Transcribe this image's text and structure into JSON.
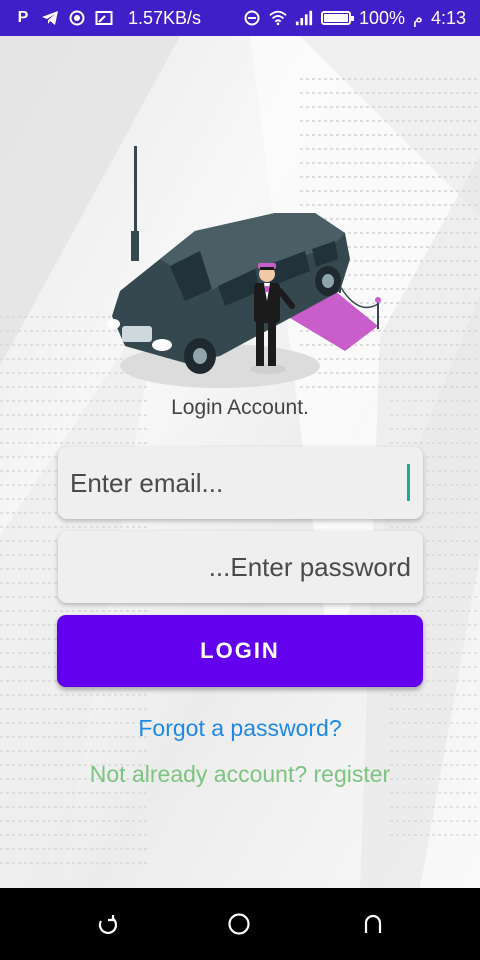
{
  "status_bar": {
    "left_icons": [
      "parking-icon",
      "telegram-icon",
      "data-saver-icon",
      "screen-cast-icon"
    ],
    "network_speed": "1.57KB/s",
    "right_icons": [
      "do-not-disturb-icon",
      "wifi-icon",
      "signal-icon"
    ],
    "battery_percent": "100%",
    "battery_level": 1.0,
    "am_pm": "م",
    "time": "4:13"
  },
  "illustration": {
    "name": "limousine-with-chauffeur-illustration",
    "colors": {
      "car_body": "#36484f",
      "carpet": "#c85ec9",
      "suit": "#1b1b1b"
    }
  },
  "login": {
    "title": "Login Account.",
    "email_placeholder": "Enter email...",
    "password_placeholder": "...Enter password",
    "login_button": "LOGIN",
    "forgot_link": "Forgot a password?",
    "register_link": "Not already account? register"
  },
  "nav_bar": {
    "buttons": [
      "back-icon",
      "home-icon",
      "recents-icon"
    ]
  },
  "colors": {
    "status_bar": "#3f1fc8",
    "primary": "#6200ee",
    "link": "#1e88e5",
    "register": "#7bc47f",
    "caret": "#1aa9a0"
  }
}
